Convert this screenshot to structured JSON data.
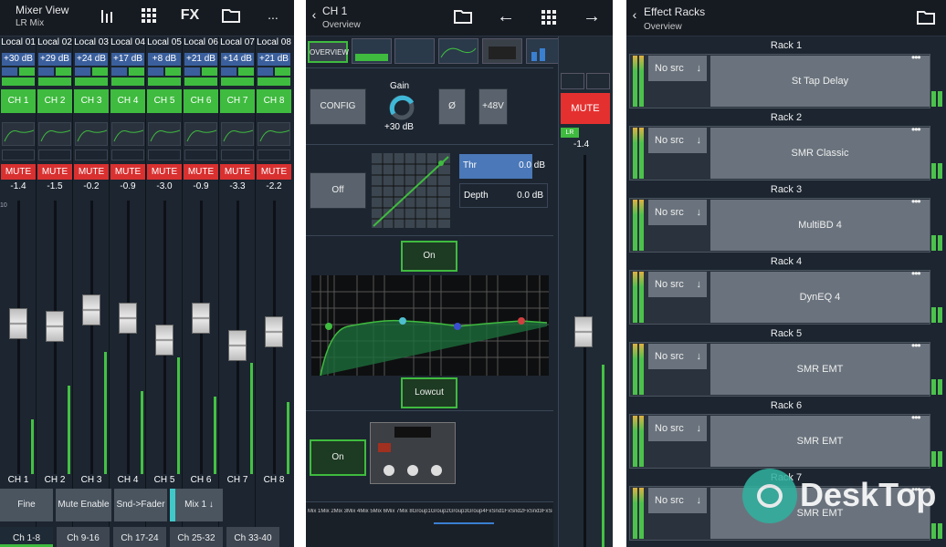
{
  "mixer": {
    "title": "Mixer View",
    "subtitle": "LR Mix",
    "icons": [
      "meters-icon",
      "grid-icon",
      "fx-icon",
      "folder-icon",
      "more-icon"
    ],
    "fx_label": "FX",
    "more_label": "...",
    "channels": [
      {
        "name": "Local 01",
        "gain": "+30 dB",
        "label": "CH 1",
        "db": "-1.4",
        "fader": 0.55
      },
      {
        "name": "Local 02",
        "gain": "+29 dB",
        "label": "CH 2",
        "db": "-1.5",
        "fader": 0.54
      },
      {
        "name": "Local 03",
        "gain": "+24 dB",
        "label": "CH 3",
        "db": "-0.2",
        "fader": 0.6
      },
      {
        "name": "Local 04",
        "gain": "+17 dB",
        "label": "CH 4",
        "db": "-0.9",
        "fader": 0.57
      },
      {
        "name": "Local 05",
        "gain": "+8 dB",
        "label": "CH 5",
        "db": "-3.0",
        "fader": 0.49
      },
      {
        "name": "Local 06",
        "gain": "+21 dB",
        "label": "CH 6",
        "db": "-0.9",
        "fader": 0.57
      },
      {
        "name": "Local 07",
        "gain": "+14 dB",
        "label": "CH 7",
        "db": "-3.3",
        "fader": 0.47
      },
      {
        "name": "Local 08",
        "gain": "+21 dB",
        "label": "CH 8",
        "db": "-2.2",
        "fader": 0.52
      }
    ],
    "mute_label": "MUTE",
    "bottom_buttons": [
      "Fine",
      "Mute Enable",
      "Snd->Fader",
      "Mix 1"
    ],
    "tabs": [
      "Ch 1-8",
      "Ch 9-16",
      "Ch 17-24",
      "Ch 25-32",
      "Ch 33-40"
    ],
    "scale": [
      "10",
      "5",
      "0",
      "-5",
      "-10",
      "-20",
      "-30",
      "-40",
      "-50"
    ]
  },
  "channel": {
    "title": "CH 1",
    "subtitle": "Overview",
    "overview_tab": "OVERVIEW",
    "config": "CONFIG",
    "gain_label": "Gain",
    "gain_value": "+30 dB",
    "phase": "Ø",
    "phantom": "+48V",
    "gate_off": "Off",
    "thr_label": "Thr",
    "thr_value": "0.0 dB",
    "depth_label": "Depth",
    "depth_value": "0.0 dB",
    "eq_on": "On",
    "lowcut": "Lowcut",
    "fx_on": "On",
    "mute": "MUTE",
    "lr": "LR",
    "db": "-1.4",
    "fader": 0.55,
    "sends_label": "Mix 1Mix 2Mix 3Mix 4Mix 5Mix 6Mix 7Mix 8Group1Group2Group3Group4FxSnd1FxSnd2FxSnd3FxSnd4"
  },
  "racks": {
    "title": "Effect Racks",
    "subtitle": "Overview",
    "no_src": "No src",
    "items": [
      {
        "title": "Rack 1",
        "effect": "St Tap Delay"
      },
      {
        "title": "Rack 2",
        "effect": "SMR Classic"
      },
      {
        "title": "Rack 3",
        "effect": "MultiBD 4"
      },
      {
        "title": "Rack 4",
        "effect": "DynEQ 4"
      },
      {
        "title": "Rack 5",
        "effect": "SMR EMT"
      },
      {
        "title": "Rack 6",
        "effect": "SMR EMT"
      },
      {
        "title": "Rack 7",
        "effect": "SMR EMT"
      }
    ]
  },
  "watermark": "DeskTop",
  "colors": {
    "green": "#3fbb3f",
    "red": "#d93030",
    "blue": "#3a5f9c",
    "panel": "#1c2530"
  }
}
